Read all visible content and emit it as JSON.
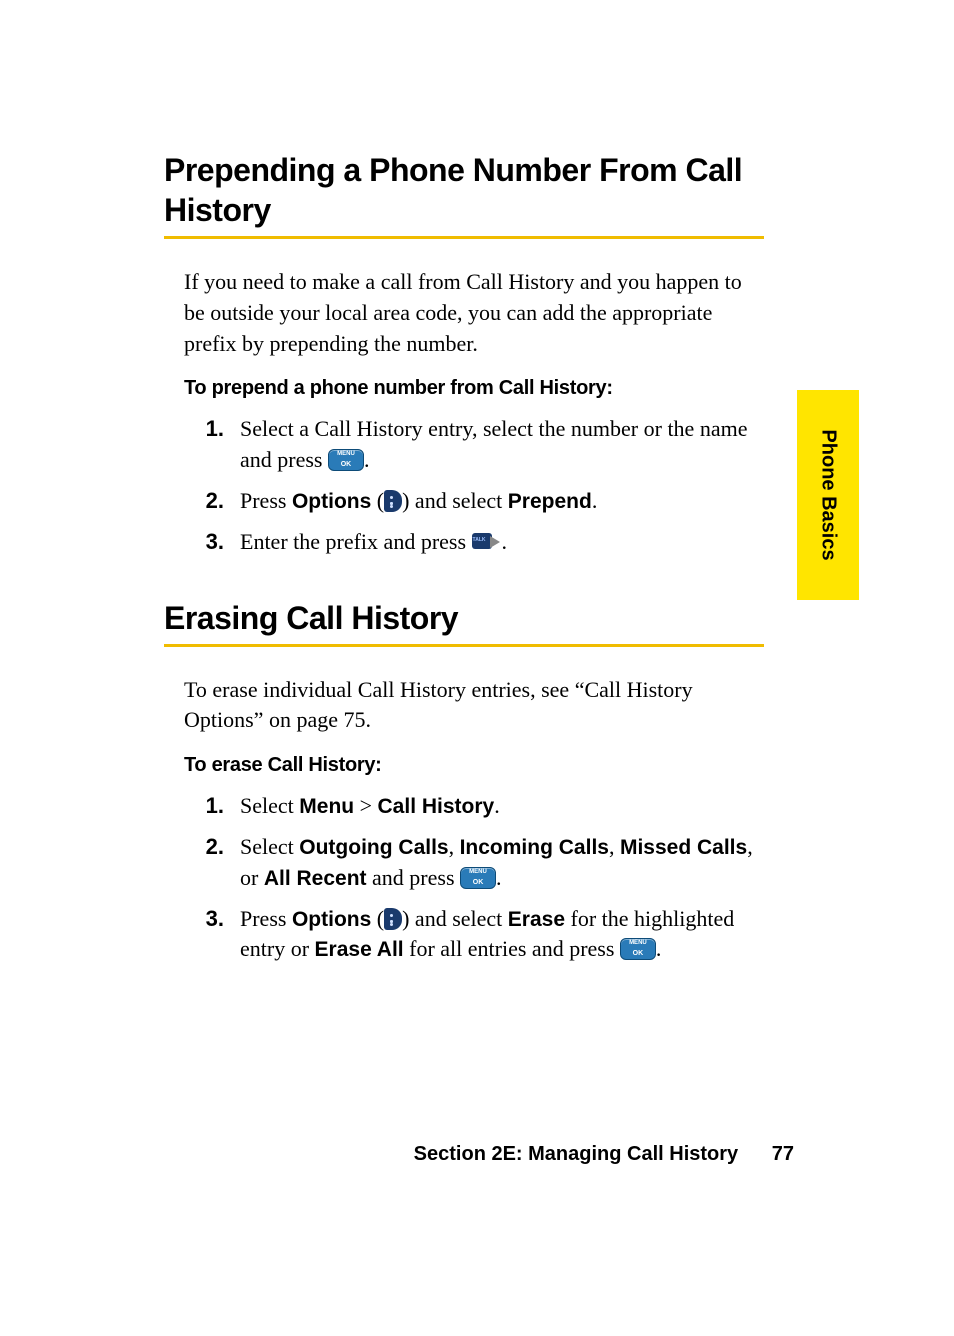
{
  "section1": {
    "title": "Prepending a Phone Number From Call History",
    "intro": "If you need to make a call from Call History and you happen to be outside your local area code, you can add the appropriate prefix by prepending the number.",
    "subhead": "To prepend a phone number from Call History:",
    "steps": {
      "s1_a": "Select a Call History entry, select the number or the name and press ",
      "s1_b": ".",
      "s2_a": "Press ",
      "s2_bold1": "Options",
      "s2_b": " (",
      "s2_c": ") and select ",
      "s2_bold2": "Prepend",
      "s2_d": ".",
      "s3_a": "Enter the prefix and press ",
      "s3_b": "."
    }
  },
  "section2": {
    "title": "Erasing Call History",
    "intro": "To erase individual Call History entries, see “Call History Options” on page 75.",
    "subhead": "To erase Call History:",
    "steps": {
      "s1_a": "Select ",
      "s1_bold1": "Menu",
      "s1_b": " > ",
      "s1_bold2": "Call History",
      "s1_c": ".",
      "s2_a": "Select ",
      "s2_bold1": "Outgoing Calls",
      "s2_b": ", ",
      "s2_bold2": "Incoming Calls",
      "s2_c": ", ",
      "s2_bold3": "Missed Calls",
      "s2_d": ", or ",
      "s2_bold4": "All Recent",
      "s2_e": " and press ",
      "s2_f": ".",
      "s3_a": "Press ",
      "s3_bold1": "Options",
      "s3_b": " (",
      "s3_c": ") and select ",
      "s3_bold2": "Erase",
      "s3_d": " for the highlighted entry or ",
      "s3_bold3": "Erase All",
      "s3_e": " for all entries and press ",
      "s3_f": "."
    }
  },
  "side_tab": "Phone Basics",
  "footer": {
    "section": "Section 2E: Managing Call History",
    "page": "77"
  },
  "nums": {
    "n1": "1.",
    "n2": "2.",
    "n3": "3."
  }
}
